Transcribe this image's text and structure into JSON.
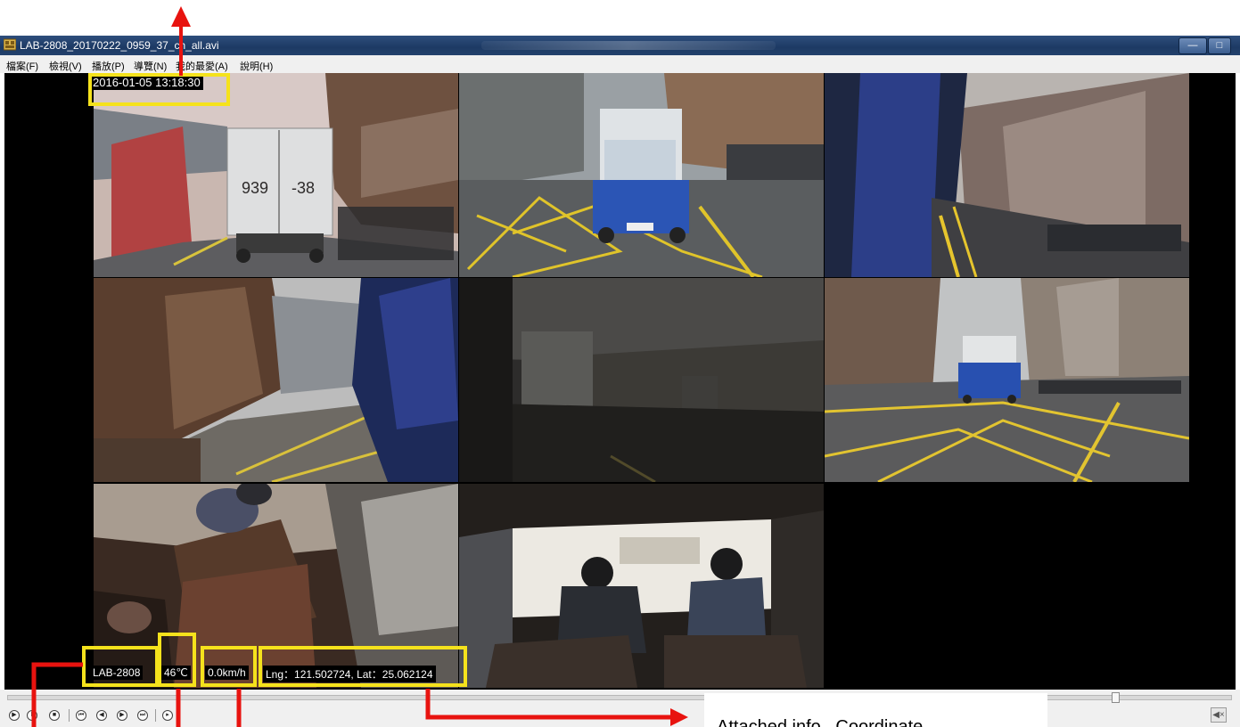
{
  "window": {
    "title": "LAB-2808_20170222_0959_37_ch_all.avi",
    "minimize_symbol": "—",
    "maximize_symbol": "□"
  },
  "menu": [
    "檔案(F)",
    "檢視(V)",
    "播放(P)",
    "導覽(N)",
    "我的最愛(A)",
    "說明(H)"
  ],
  "overlay": {
    "timestamp": "2016-01-05 13:18:30",
    "plate": "LAB-2808",
    "temperature": "46℃",
    "speed": "0.0km/h",
    "coordinate": "Lng：121.502724, Lat：25.062124"
  },
  "camera_scene": {
    "truck_left_number": "939",
    "truck_right_number": "-38"
  },
  "playback": {
    "seek_fraction": 0.905,
    "controls": [
      "play-icon",
      "pause-icon",
      "stop-icon",
      "skip-start-icon",
      "step-back-icon",
      "step-forward-icon",
      "skip-end-icon",
      "frame-icon"
    ],
    "mute_symbol": "◀×"
  },
  "annotation": {
    "text": "Attached info –Coordinate"
  },
  "colors": {
    "highlight": "#f5e21c",
    "arrow": "#e8130f",
    "titlebar": "#1d3a64"
  }
}
